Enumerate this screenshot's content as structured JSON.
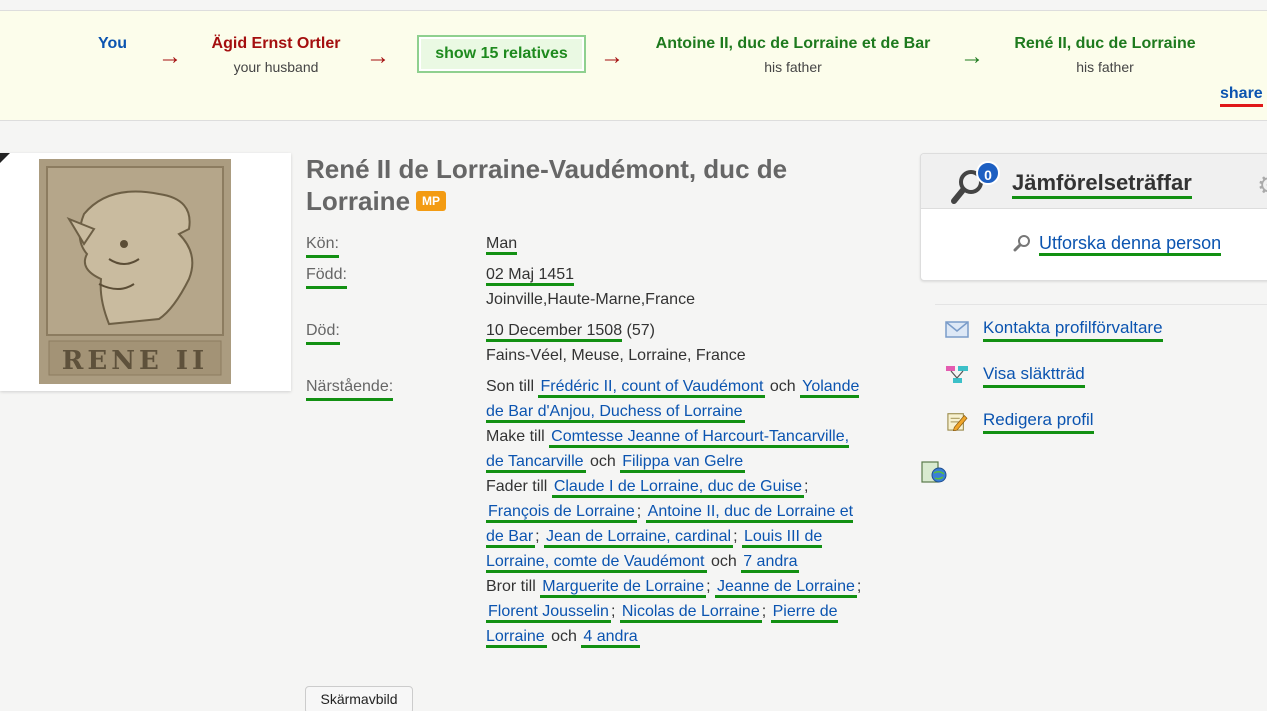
{
  "relationship": {
    "nodes": [
      {
        "name": "You",
        "sub": "",
        "color": "#0b54b0"
      },
      {
        "name": "Ägid Ernst Ortler",
        "sub": "your husband",
        "color": "#a40f0f"
      },
      {
        "name": "Antoine II, duc de Lorraine et de Bar",
        "sub": "his father",
        "color": "#1e7a1e"
      },
      {
        "name": "René II, duc de Lorraine",
        "sub": "his father",
        "color": "#1e7a1e"
      }
    ],
    "arrows": [
      "→",
      "→",
      "→",
      "→"
    ],
    "show_relatives": "show 15 relatives",
    "share": "share"
  },
  "profile": {
    "name": "René II de Lorraine-Vaudémont, duc de Lorraine",
    "badge": "MP",
    "photo_inscription": "RENE II"
  },
  "facts": {
    "gender_label": "Kön:",
    "gender": "Man",
    "born_label": "Född:",
    "born_date": "02 Maj 1451",
    "born_place": "Joinville,Haute-Marne,France",
    "died_label": "Död:",
    "died_date": "10 December 1508",
    "died_age": "(57)",
    "died_place": "Fains-Véel, Meuse, Lorraine, France",
    "relatives_label": "Närstående:",
    "son_of": "Son till",
    "husband_of": "Make till",
    "father_of": "Fader till",
    "brother_of": "Bror till",
    "and": "och",
    "sep": ";",
    "parents": [
      "Frédéric II, count of Vaudémont",
      "Yolande de Bar d'Anjou, Duchess of Lorraine"
    ],
    "spouses": [
      "Comtesse Jeanne of Harcourt-Tancarville, de Tancarville",
      "Filippa van Gelre"
    ],
    "children": [
      "Claude I de Lorraine, duc de Guise",
      "François de Lorraine",
      "Antoine II, duc de Lorraine et de Bar",
      "Jean de Lorraine, cardinal",
      "Louis III de Lorraine, comte de Vaudémont",
      "7 andra"
    ],
    "siblings": [
      "Marguerite de Lorraine",
      "Jeanne de Lorraine",
      "Florent Jousselin",
      "Nicolas de Lorraine",
      "Pierre de Lorraine",
      "4 andra"
    ]
  },
  "screenshot_button": "Skärmavbild",
  "sidebar": {
    "match_count": "0",
    "match_title": "Jämförelseträffar",
    "explore": "Utforska denna person",
    "links": [
      {
        "label": "Kontakta profilförvaltare",
        "icon": "mail-icon"
      },
      {
        "label": "Visa släktträd",
        "icon": "tree-icon"
      },
      {
        "label": "Redigera profil",
        "icon": "edit-icon"
      }
    ]
  }
}
